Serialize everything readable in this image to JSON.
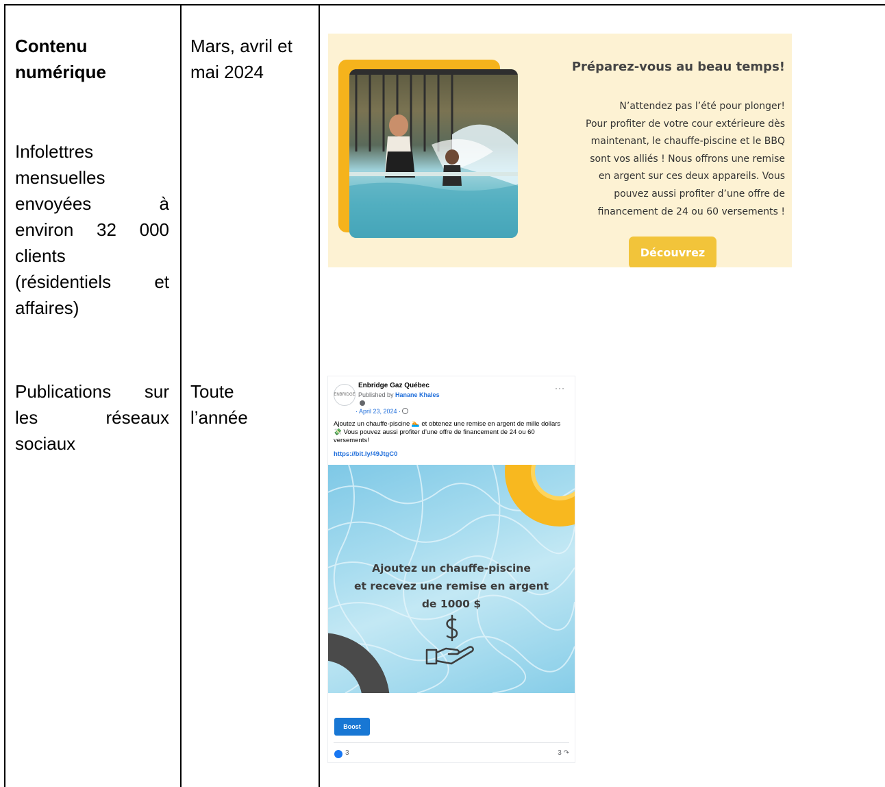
{
  "table": {
    "row1": {
      "category_title": [
        "Contenu",
        "numérique"
      ],
      "category_sub": [
        "Infolettres",
        "mensuelles",
        "envoyées à",
        "environ 32 000",
        "clients",
        "(résidentiels et",
        "affaires)"
      ],
      "period": [
        "Mars, avril et",
        "mai 2024"
      ]
    },
    "row2": {
      "category": [
        "Publications sur",
        "les réseaux",
        "sociaux"
      ],
      "period": [
        "Toute",
        "l’année"
      ]
    }
  },
  "newsletter": {
    "title": "Préparez-vous au beau temps!",
    "body": [
      "N’attendez pas l’été pour plonger!",
      "Pour profiter de votre cour extérieure dès",
      "maintenant, le chauffe-piscine et le BBQ",
      "sont vos alliés ! Nous offrons une remise",
      "en argent sur ces deux appareils. Vous",
      "pouvez aussi profiter d’une offre de",
      "financement de 24 ou 60 versements !"
    ],
    "cta": "Découvrez",
    "colors": {
      "banner_bg": "#fdf2d3",
      "accent": "#f5b31c",
      "button": "#f2c43a"
    }
  },
  "social_post": {
    "page_name": "Enbridge Gaz Québec",
    "published_by_prefix": "Published by ",
    "author": "Hanane Khales",
    "date": "· April 23, 2024 ·",
    "text": "Ajoutez un chauffe-piscine 🏊 et obtenez une remise en argent de mille dollars 💸 Vous pouvez aussi profiter d’une offre de financement de 24 ou 60 versements!",
    "link": "https://bit.ly/49JtgC0",
    "image_lines": [
      "Ajoutez un chauffe-piscine",
      "et recevez une remise en argent",
      "de 1000 $"
    ],
    "boost_label": "Boost",
    "likes": "3",
    "shares": "3",
    "more": "···",
    "logo_text": "ENBRIDGE",
    "colors": {
      "link": "#216fdb",
      "boost": "#1877d4"
    }
  }
}
